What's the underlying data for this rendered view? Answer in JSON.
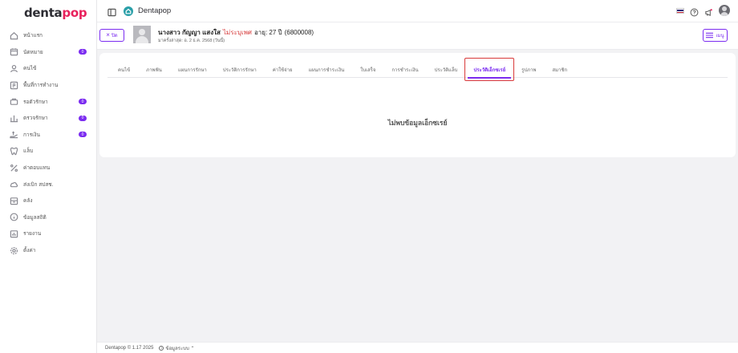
{
  "brand": {
    "logo_main": "denta",
    "logo_accent": "pop"
  },
  "colors": {
    "accent": "#7b2cf0",
    "brand_pink": "#e8215c",
    "app_icon": "#2a9fa8",
    "warning_red": "#d63a3a"
  },
  "sidebar": {
    "items": [
      {
        "label": "หน้าแรก",
        "icon": "home-icon",
        "badge": null
      },
      {
        "label": "นัดหมาย",
        "icon": "calendar-icon",
        "badge": "0"
      },
      {
        "label": "คนไข้",
        "icon": "user-icon",
        "badge": null
      },
      {
        "label": "พื้นที่การทำงาน",
        "icon": "workspace-icon",
        "badge": null
      },
      {
        "label": "รอตัวรักษา",
        "icon": "waiting-icon",
        "badge": "0"
      },
      {
        "label": "ตรวจรักษา",
        "icon": "treatment-icon",
        "badge": "0"
      },
      {
        "label": "การเงิน",
        "icon": "finance-icon",
        "badge": "0"
      },
      {
        "label": "แล็บ",
        "icon": "lab-icon",
        "badge": null
      },
      {
        "label": "ค่าตอบแทน",
        "icon": "percent-icon",
        "badge": null
      },
      {
        "label": "ส่งเบิก สปสช.",
        "icon": "cloud-icon",
        "badge": null
      },
      {
        "label": "คลัง",
        "icon": "inventory-icon",
        "badge": null
      },
      {
        "label": "ข้อมูลสถิติ",
        "icon": "info-icon",
        "badge": null
      },
      {
        "label": "รายงาน",
        "icon": "report-icon",
        "badge": null
      },
      {
        "label": "ตั้งค่า",
        "icon": "settings-icon",
        "badge": null
      }
    ]
  },
  "header": {
    "title": "Dentapop"
  },
  "patient": {
    "close_label": "ปิด",
    "name": "นางสาว กัญญา แสงใส",
    "gender": "ไม่ระบุเพศ",
    "age": "อายุ: 27 ปี",
    "hn": "(6800008)",
    "last_visit": "มาครั้งล่าสุด: อ. 2 ธ.ค. 2568 (วันนี้)",
    "menu_label": "เมนู"
  },
  "tabs": [
    {
      "label": "คนไข้",
      "active": false
    },
    {
      "label": "ภาพฟัน",
      "active": false
    },
    {
      "label": "แผนการรักษา",
      "active": false
    },
    {
      "label": "ประวัติการรักษา",
      "active": false
    },
    {
      "label": "ค่าใช้จ่าย",
      "active": false
    },
    {
      "label": "แผนการชำระเงิน",
      "active": false
    },
    {
      "label": "ใบเสร็จ",
      "active": false
    },
    {
      "label": "การชำระเงิน",
      "active": false
    },
    {
      "label": "ประวัติแล็บ",
      "active": false
    },
    {
      "label": "ประวัติเอ็กซเรย์",
      "active": true
    },
    {
      "label": "รูปภาพ",
      "active": false
    },
    {
      "label": "สมาชิก",
      "active": false
    }
  ],
  "main": {
    "empty_message": "ไม่พบข้อมูลเอ็กซเรย์"
  },
  "footer": {
    "copyright": "Dentapop © 1.17 2025",
    "info_label": "ข้อมูลระบบ ⌃"
  }
}
